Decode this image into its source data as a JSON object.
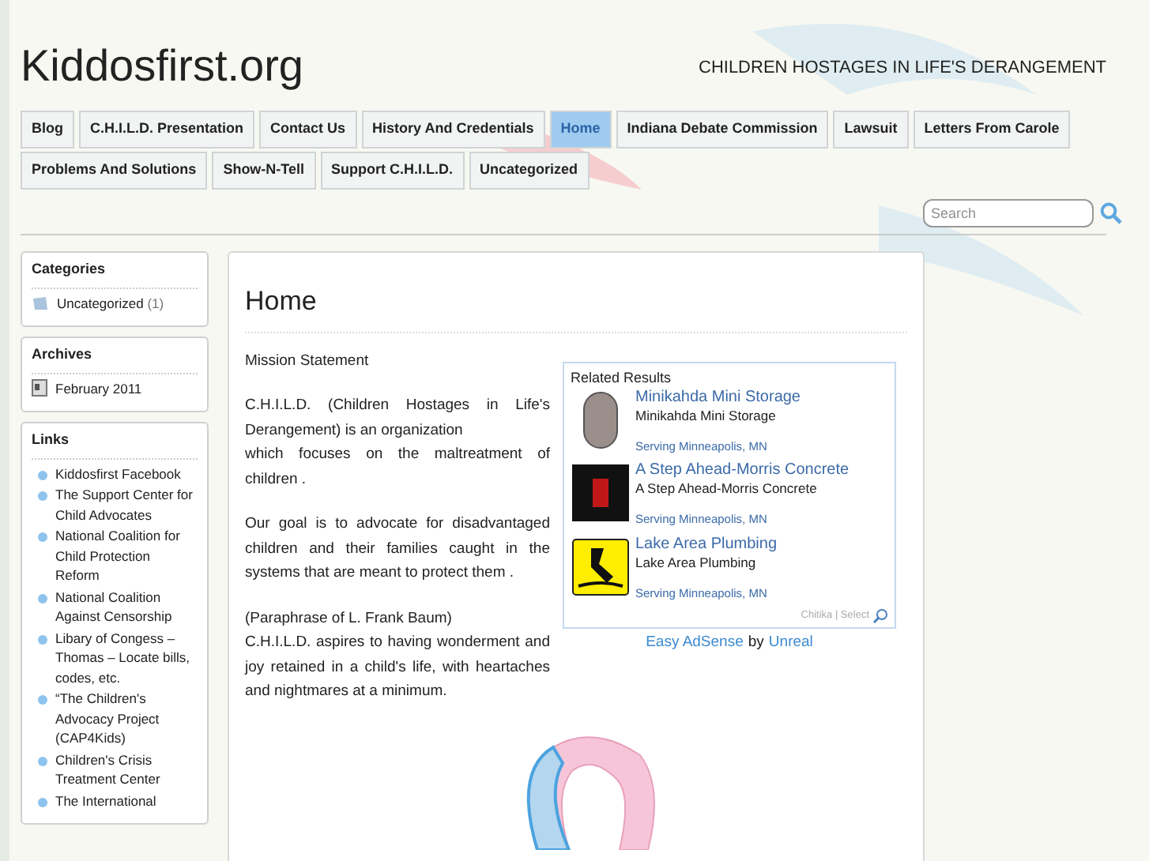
{
  "site": {
    "title": "Kiddosfirst.org",
    "tagline": "CHILDREN HOSTAGES IN LIFE'S DERANGEMENT"
  },
  "nav": [
    {
      "label": "Blog",
      "selected": false
    },
    {
      "label": "C.H.I.L.D. Presentation",
      "selected": false
    },
    {
      "label": "Contact Us",
      "selected": false
    },
    {
      "label": "History And Credentials",
      "selected": false
    },
    {
      "label": "Home",
      "selected": true
    },
    {
      "label": "Indiana Debate Commission",
      "selected": false
    },
    {
      "label": "Lawsuit",
      "selected": false
    },
    {
      "label": "Letters From Carole",
      "selected": false
    },
    {
      "label": "Problems And Solutions",
      "selected": false
    },
    {
      "label": "Show-N-Tell",
      "selected": false
    },
    {
      "label": "Support C.H.I.L.D.",
      "selected": false
    },
    {
      "label": "Uncategorized",
      "selected": false
    }
  ],
  "search": {
    "placeholder": "Search"
  },
  "sidebar": [
    {
      "title": "Categories",
      "kind": "category",
      "items": [
        {
          "label": "Uncategorized",
          "count": "(1)"
        }
      ]
    },
    {
      "title": "Archives",
      "kind": "archive",
      "items": [
        {
          "label": "February 2011"
        }
      ]
    },
    {
      "title": "Links",
      "kind": "link",
      "items": [
        {
          "label": "Kiddosfirst Facebook"
        },
        {
          "label": "The Support Center for Child Advocates"
        },
        {
          "label": "National Coalition for Child Protection Reform"
        },
        {
          "label": "National Coalition Against Censorship"
        },
        {
          "label": "Libary of Congess – Thomas – Locate bills, codes, etc."
        },
        {
          "label": "“The Children's Advocacy Project (CAP4Kids)"
        },
        {
          "label": "Children's Crisis Treatment Center"
        },
        {
          "label": "The International"
        }
      ]
    }
  ],
  "post": {
    "title": "Home",
    "paragraphs": [
      "Mission Statement",
      "C.H.I.L.D. (Children Hostages in Life's Derangement) is an organization\nwhich focuses on the maltreatment of children .",
      "Our goal is to advocate for disadvantaged children and their families caught in the systems that are meant to protect them .",
      "(Paraphrase of L. Frank Baum)\nC.H.I.L.D. aspires to having wonderment and joy retained in a child's life, with heartaches and nightmares at a minimum."
    ]
  },
  "ads": {
    "title": "Related Results",
    "items": [
      {
        "kind": "storage",
        "name": "Minikahda Mini Storage",
        "desc": "Minikahda Mini Storage",
        "area": "Serving Minneapolis, MN"
      },
      {
        "kind": "concrete",
        "name": "A Step Ahead-Morris Concrete",
        "desc": "A Step Ahead-Morris Concrete",
        "area": "Serving Minneapolis, MN"
      },
      {
        "kind": "plumbing",
        "name": "Lake Area Plumbing",
        "desc": "Lake Area Plumbing",
        "area": "Serving Minneapolis, MN"
      }
    ],
    "footer": "Chitika | Select",
    "credit": {
      "plugin": "Easy AdSense",
      "by": "by",
      "author": "Unreal"
    }
  }
}
